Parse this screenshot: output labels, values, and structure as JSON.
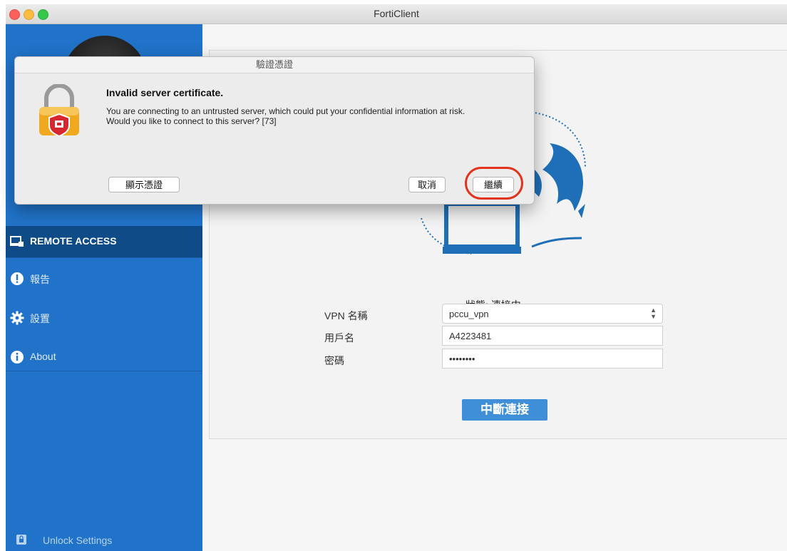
{
  "window": {
    "title": "FortiClient"
  },
  "sidebar": {
    "items": [
      {
        "label": "REMOTE ACCESS",
        "active": true,
        "icon": "remote-access-icon"
      },
      {
        "label": "報告",
        "active": false,
        "icon": "alert-icon"
      },
      {
        "label": "設置",
        "active": false,
        "icon": "gear-icon"
      },
      {
        "label": "About",
        "active": false,
        "icon": "info-icon"
      }
    ],
    "unlock_label": "Unlock Settings"
  },
  "main": {
    "status": "狀態: 連接中",
    "vpn_name_label": "VPN 名稱",
    "vpn_name_value": "pccu_vpn",
    "username_label": "用戶名",
    "username_value": "A4223481",
    "password_label": "密碼",
    "password_value": "••••••••",
    "disconnect_button": "中斷連接"
  },
  "dialog": {
    "title": "驗證憑證",
    "heading": "Invalid server certificate.",
    "message": "You are connecting to an untrusted server, which could put your confidential information at risk. Would you like to connect to this server? [73]",
    "show_cert_button": "顯示憑證",
    "cancel_button": "取消",
    "continue_button": "繼續"
  },
  "colors": {
    "sidebar": "#2173c9",
    "accent": "#3e8fd7",
    "highlight": "#e2341d"
  }
}
